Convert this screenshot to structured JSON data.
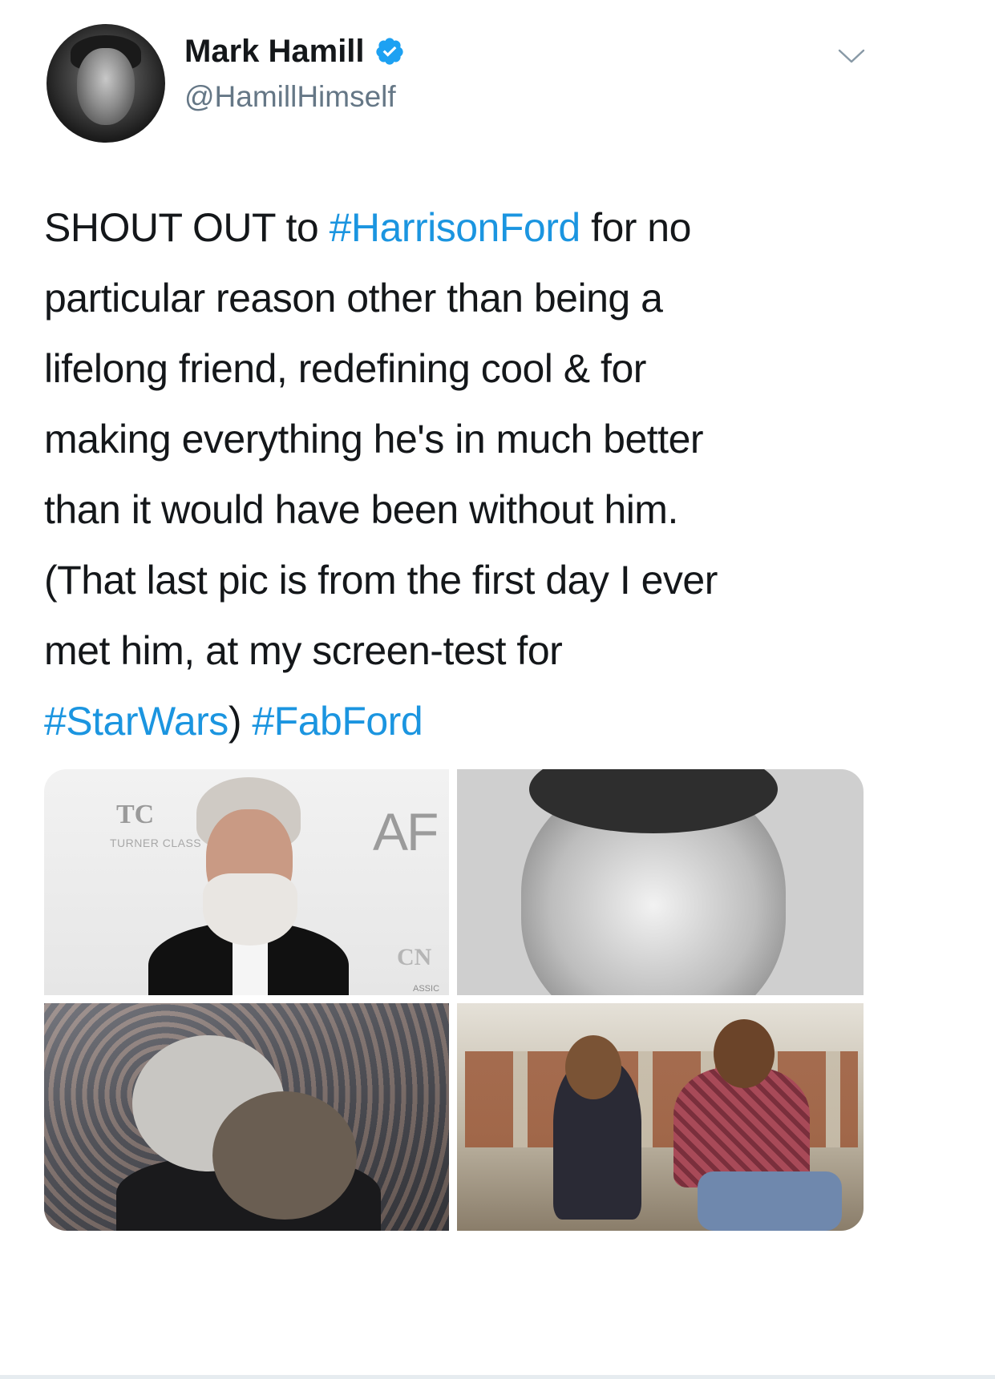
{
  "author": {
    "display_name": "Mark Hamill",
    "handle": "@HamillHimself",
    "verified": true
  },
  "tweet": {
    "lines": [
      [
        {
          "text": "SHOUT OUT to ",
          "hashtag": false
        },
        {
          "text": "#HarrisonFord",
          "hashtag": true
        },
        {
          "text": " for no",
          "hashtag": false
        }
      ],
      [
        {
          "text": "particular reason other than being a",
          "hashtag": false
        }
      ],
      [
        {
          "text": "lifelong friend, redefining cool & for",
          "hashtag": false
        }
      ],
      [
        {
          "text": "making everything he's in much better",
          "hashtag": false
        }
      ],
      [
        {
          "text": "than it would have been without him.",
          "hashtag": false
        }
      ],
      [
        {
          "text": "(That last pic is from the first day I ever",
          "hashtag": false
        }
      ],
      [
        {
          "text": "met him, at my screen-test for",
          "hashtag": false
        }
      ],
      [
        {
          "text": "#StarWars",
          "hashtag": true
        },
        {
          "text": ") ",
          "hashtag": false
        },
        {
          "text": "#FabFord",
          "hashtag": true
        }
      ]
    ]
  },
  "media": {
    "photo_1": {
      "logo_tcm": "TC",
      "logo_tcm_sub": "TURNER CLASS",
      "logo_afi": "AF",
      "logo_cn": "CN",
      "logo_classic": "ASSIC"
    }
  },
  "colors": {
    "hashtag": "#1b95e0",
    "text": "#14171a",
    "secondary": "#657786",
    "verified": "#1da1f2"
  },
  "icons": {
    "verified": "verified-badge-icon",
    "more": "chevron-down-icon"
  }
}
